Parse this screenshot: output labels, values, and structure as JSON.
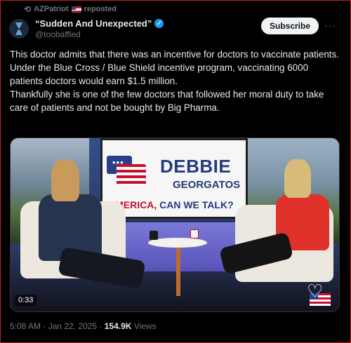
{
  "repost": {
    "user": "AZPatriot",
    "suffix": "reposted"
  },
  "author": {
    "display_name": "“Sudden And Unexpected”",
    "handle": "@toobaffled",
    "subscribe_label": "Subscribe",
    "more_label": "···"
  },
  "tweet": {
    "lines": [
      "This doctor admits that there was  an incentive for doctors to vaccinate patients.",
      "Under the Blue Cross / Blue Shield incentive program, vaccinating 6000 patients doctors would earn $1.5 million.",
      "Thankfully she is one of the few doctors that followed her moral duty to take care of patients and not be bought by Big Pharma."
    ]
  },
  "video": {
    "screen_title_1": "DEBBIE",
    "screen_title_2": "GEORGATOS",
    "screen_tagline_a": "AMERICA,",
    "screen_tagline_b": " CAN WE TALK?",
    "duration": "0:33"
  },
  "footer": {
    "time": "5:08 AM · Jan 22, 2025 · ",
    "views_count": "154.9K",
    "views_label": " Views"
  },
  "colors": {
    "accent": "#1d9bf0",
    "background": "#000000",
    "brand_red": "#c8102e",
    "brand_blue": "#243a7a"
  }
}
